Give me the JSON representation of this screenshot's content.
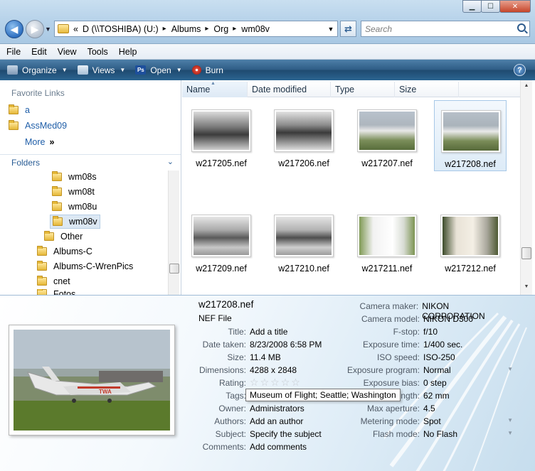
{
  "window": {
    "minimize": "0",
    "maximize": "1",
    "close": "r"
  },
  "address": {
    "crumbs": [
      "«",
      "D (\\\\TOSHIBA) (U:)",
      "Albums",
      "Org",
      "wm08v"
    ],
    "separator": "▸"
  },
  "search": {
    "placeholder": "Search"
  },
  "menu": [
    "File",
    "Edit",
    "View",
    "Tools",
    "Help"
  ],
  "commands": {
    "organize": "Organize",
    "views": "Views",
    "open": "Open",
    "burn": "Burn",
    "help": "?"
  },
  "favorites": {
    "title": "Favorite Links",
    "items": [
      "a",
      "AssMed09"
    ],
    "more": "More",
    "more_glyph": "»"
  },
  "folders": {
    "title": "Folders",
    "items": [
      {
        "label": "wm08s"
      },
      {
        "label": "wm08t"
      },
      {
        "label": "wm08u"
      },
      {
        "label": "wm08v",
        "selected": true
      },
      {
        "label": "Other"
      },
      {
        "label": "Albums-C"
      },
      {
        "label": "Albums-C-WrenPics"
      },
      {
        "label": "cnet"
      },
      {
        "label": "Fotos"
      }
    ]
  },
  "columns": [
    "Name",
    "Date modified",
    "Type",
    "Size"
  ],
  "files": [
    {
      "name": "w217205.nef",
      "selected": false
    },
    {
      "name": "w217206.nef",
      "selected": false
    },
    {
      "name": "w217207.nef",
      "selected": false
    },
    {
      "name": "w217208.nef",
      "selected": true
    },
    {
      "name": "w217209.nef",
      "selected": false
    },
    {
      "name": "w217210.nef",
      "selected": false
    },
    {
      "name": "w217211.nef",
      "selected": false
    },
    {
      "name": "w217212.nef",
      "selected": false
    }
  ],
  "details": {
    "filename": "w217208.nef",
    "filetype": "NEF File",
    "left_props": [
      {
        "key": "Title:",
        "value": "Add a title"
      },
      {
        "key": "Date taken:",
        "value": "8/23/2008 6:58 PM"
      },
      {
        "key": "Size:",
        "value": "11.4 MB"
      },
      {
        "key": "Dimensions:",
        "value": "4288 x 2848"
      },
      {
        "key": "Rating:",
        "value": ""
      },
      {
        "key": "Tags:",
        "value": ""
      },
      {
        "key": "Owner:",
        "value": "Administrators"
      },
      {
        "key": "Authors:",
        "value": "Add an author"
      },
      {
        "key": "Subject:",
        "value": "Specify the subject"
      },
      {
        "key": "Comments:",
        "value": "Add comments"
      }
    ],
    "rating_stars": 0,
    "tags_tooltip": "Museum of Flight; Seattle; Washington",
    "right_props": [
      {
        "key": "Camera maker:",
        "value": "NIKON CORPORATION"
      },
      {
        "key": "Camera model:",
        "value": "NIKON D300"
      },
      {
        "key": "F-stop:",
        "value": "f/10"
      },
      {
        "key": "Exposure time:",
        "value": "1/400 sec."
      },
      {
        "key": "ISO speed:",
        "value": "ISO-250"
      },
      {
        "key": "Exposure program:",
        "value": "Normal"
      },
      {
        "key": "Exposure bias:",
        "value": "0 step"
      },
      {
        "key": "Focal length:",
        "value": "62 mm"
      },
      {
        "key": "Max aperture:",
        "value": "4.5"
      },
      {
        "key": "Metering mode:",
        "value": "Spot"
      },
      {
        "key": "Flash mode:",
        "value": "No Flash"
      }
    ]
  }
}
